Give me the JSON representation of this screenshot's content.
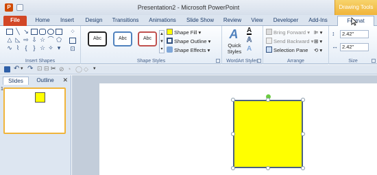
{
  "title_bar": {
    "title": "Presentation2  -  Microsoft PowerPoint",
    "context_tab": "Drawing Tools",
    "app_icon": "P"
  },
  "tabs": [
    "File",
    "Home",
    "Insert",
    "Design",
    "Transitions",
    "Animations",
    "Slide Show",
    "Review",
    "View",
    "Developer",
    "Add-Ins",
    "Format"
  ],
  "active_tab": "Format",
  "ribbon": {
    "insert_shapes": {
      "label": "Insert Shapes"
    },
    "shape_styles": {
      "label": "Shape Styles",
      "gallery": [
        {
          "text": "Abc",
          "border": "#222222"
        },
        {
          "text": "Abc",
          "border": "#4f81bd"
        },
        {
          "text": "Abc",
          "border": "#c0504d"
        }
      ],
      "fill": "Shape Fill",
      "outline": "Shape Outline",
      "effects": "Shape Effects"
    },
    "wordart_styles": {
      "label": "WordArt Styles",
      "quick_styles": "Quick Styles"
    },
    "arrange": {
      "label": "Arrange",
      "bring_forward": "Bring Forward",
      "send_backward": "Send Backward",
      "selection_pane": "Selection Pane"
    },
    "size": {
      "label": "Size",
      "height": "2.42\"",
      "width": "2.42\""
    }
  },
  "slides_pane": {
    "tabs": [
      "Slides",
      "Outline"
    ],
    "close": "✕",
    "slide_number": "1"
  },
  "colors": {
    "file_tab": "#d24726",
    "shape_fill": "#ffff00",
    "shape_outline": "#4a6082",
    "context_tab": "#f0b43a"
  }
}
